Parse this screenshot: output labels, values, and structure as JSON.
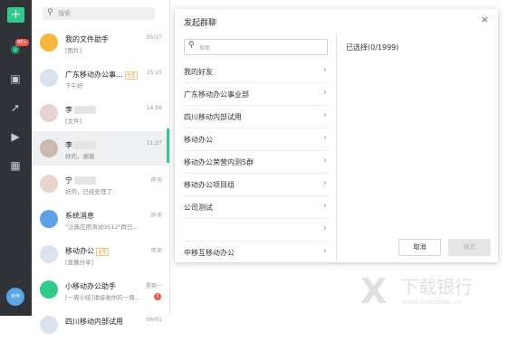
{
  "rail": {
    "new_label": "+",
    "badge": "99+",
    "icons": [
      "chat-icon",
      "contacts-icon",
      "rocket-icon",
      "video-icon",
      "apps-icon"
    ],
    "me_label": "林萍"
  },
  "search": {
    "placeholder": "搜索"
  },
  "chats": [
    {
      "name": "我的文件助手",
      "preview": "[图片]",
      "time": "05/27",
      "color": "#f5b83c"
    },
    {
      "name": "广东移动办公事...",
      "tag": "全员",
      "preview": "下午好",
      "time": "15:15",
      "color": "#d9e3ee"
    },
    {
      "name": "李",
      "preview": "[文件]",
      "time": "14:56",
      "color": "#e9d3d0"
    },
    {
      "name": "李",
      "preview": "好的，谢谢",
      "time": "11:27",
      "color": "#cbb9b0"
    },
    {
      "name": "宁",
      "preview": "好的，已经处理了",
      "time": "昨天",
      "color": "#e8d5cc"
    },
    {
      "name": "系统消息",
      "preview": "\"泛典应用测试0512\"群已...",
      "time": "昨天",
      "color": "#5ea1e8"
    },
    {
      "name": "移动办公",
      "tag": "全员",
      "preview": "[直播分享]",
      "time": "昨天",
      "color": "#d9e3ee"
    },
    {
      "name": "小移动办公助手",
      "preview": "[一周小结]请接收你的一周...",
      "time": "星期一",
      "color": "#2ecb8c",
      "badge": "1"
    },
    {
      "name": "四川移动内部试用",
      "preview": "",
      "time": "06/01",
      "color": "#d9e3ee"
    }
  ],
  "dialog": {
    "title": "发起群聊",
    "close": "×",
    "search_placeholder": "搜索",
    "selected": "已选择(0/1999)",
    "groups": [
      "我的好友",
      "广东移动办公事业部",
      "四川移动内部试用",
      "移动办公",
      "移动办公荣营内测5群",
      "移动办公项目组",
      "公司测试",
      "",
      "中移互移动办公"
    ],
    "cancel": "取消",
    "ok": "确定"
  },
  "watermark": {
    "title": "下载银行",
    "url": "www.downbank.cn"
  }
}
